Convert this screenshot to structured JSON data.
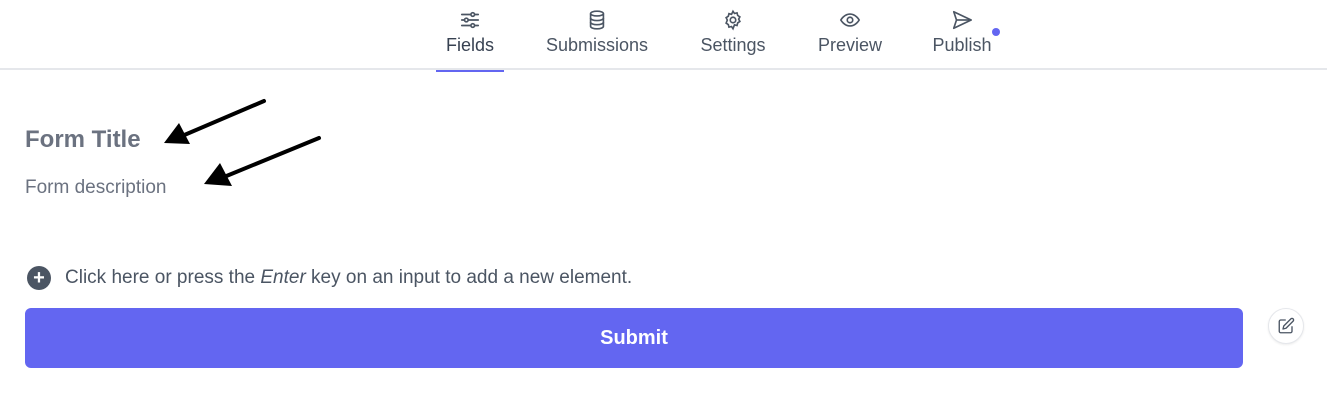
{
  "nav": {
    "tabs": [
      {
        "label": "Fields",
        "icon": "sliders-icon",
        "active": true
      },
      {
        "label": "Submissions",
        "icon": "database-icon",
        "active": false
      },
      {
        "label": "Settings",
        "icon": "gear-icon",
        "active": false
      },
      {
        "label": "Preview",
        "icon": "eye-icon",
        "active": false
      },
      {
        "label": "Publish",
        "icon": "send-icon",
        "active": false
      }
    ]
  },
  "form": {
    "title": "Form Title",
    "description": "Form description",
    "add_hint_prefix": "Click here or press the ",
    "add_hint_key": "Enter",
    "add_hint_suffix": " key on an input to add a new element.",
    "submit_label": "Submit"
  },
  "colors": {
    "accent": "#6366f1",
    "text": "#374151",
    "muted": "#6b7280"
  }
}
